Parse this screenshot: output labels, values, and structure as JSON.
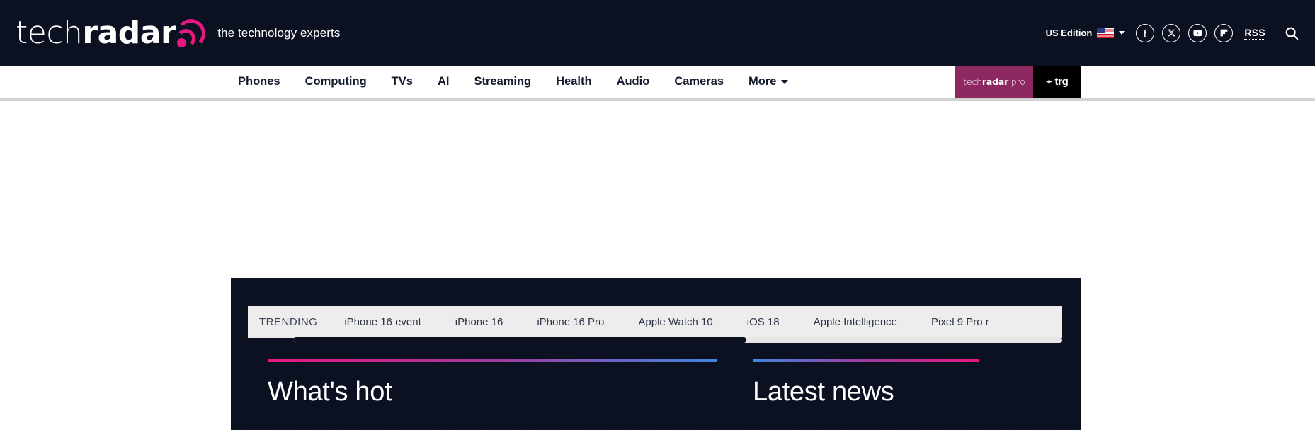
{
  "site": {
    "logo_text_light": "tech",
    "logo_text_bold": "radar",
    "logo_icon": "radar-signal-icon",
    "tagline": "the technology experts"
  },
  "header": {
    "edition": {
      "label": "US Edition",
      "flag_icon": "us-flag-icon",
      "caret_icon": "chevron-down-icon"
    },
    "social": [
      {
        "name": "facebook-icon",
        "glyph": "f"
      },
      {
        "name": "x-twitter-icon",
        "glyph": "X"
      },
      {
        "name": "youtube-icon",
        "glyph": "youtube"
      },
      {
        "name": "flipboard-icon",
        "glyph": "flipboard"
      }
    ],
    "rss_label": "RSS",
    "search_icon": "search-icon"
  },
  "nav": {
    "items": [
      {
        "label": "Phones",
        "has_caret": false
      },
      {
        "label": "Computing",
        "has_caret": false
      },
      {
        "label": "TVs",
        "has_caret": false
      },
      {
        "label": "AI",
        "has_caret": false
      },
      {
        "label": "Streaming",
        "has_caret": false
      },
      {
        "label": "Health",
        "has_caret": false
      },
      {
        "label": "Audio",
        "has_caret": false
      },
      {
        "label": "Cameras",
        "has_caret": false
      },
      {
        "label": "More",
        "has_caret": true
      }
    ],
    "badges": {
      "pro_prefix": "tech",
      "pro_bold": "radar",
      "pro_suffix": "pro",
      "trg_label": "trg"
    }
  },
  "trending": {
    "label": "TRENDING",
    "items": [
      "iPhone 16 event",
      "iPhone 16",
      "iPhone 16 Pro",
      "Apple Watch 10",
      "iOS 18",
      "Apple Intelligence",
      "Pixel 9 Pro r"
    ]
  },
  "sections": {
    "hot": {
      "title": "What's hot"
    },
    "latest": {
      "title": "Latest news"
    }
  },
  "colors": {
    "background_dark": "#0c1122",
    "accent_pink": "#e6177f",
    "accent_blue": "#3f86e0",
    "pro_badge": "#8e2860",
    "trending_bg": "#ededed"
  }
}
